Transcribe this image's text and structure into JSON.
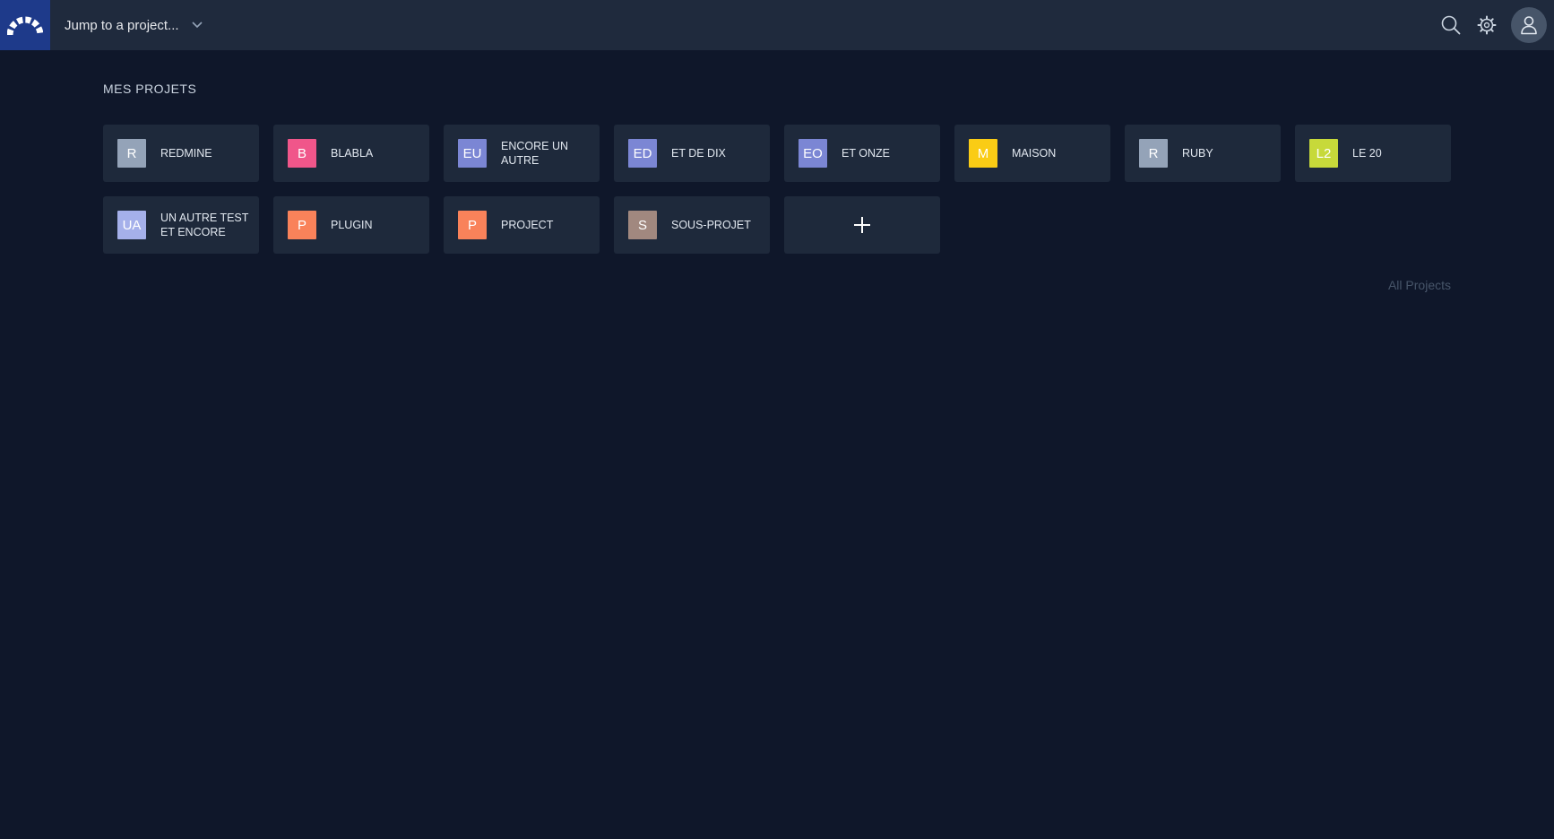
{
  "header": {
    "jump_label": "Jump to a project...",
    "icons": [
      "search-icon",
      "gear-icon",
      "user-icon"
    ]
  },
  "main": {
    "section_title": "MES PROJETS",
    "projects": [
      {
        "initials": "R",
        "name": "REDMINE",
        "color": "#94a3b8"
      },
      {
        "initials": "B",
        "name": "BLABLA",
        "color": "#f0568a"
      },
      {
        "initials": "EU",
        "name": "ENCORE UN AUTRE",
        "color": "#7b86d4"
      },
      {
        "initials": "ED",
        "name": "ET DE DIX",
        "color": "#7b86d4"
      },
      {
        "initials": "EO",
        "name": "ET ONZE",
        "color": "#7b86d4"
      },
      {
        "initials": "M",
        "name": "MAISON",
        "color": "#facc15"
      },
      {
        "initials": "R",
        "name": "RUBY",
        "color": "#94a3b8"
      },
      {
        "initials": "L2",
        "name": "LE 20",
        "color": "#c7d93a"
      },
      {
        "initials": "UA",
        "name": "UN AUTRE TEST ET ENCORE",
        "color": "#a5b0ea"
      },
      {
        "initials": "P",
        "name": "PLUGIN",
        "color": "#f9825a"
      },
      {
        "initials": "P",
        "name": "PROJECT",
        "color": "#f9825a"
      },
      {
        "initials": "S",
        "name": "SOUS-PROJET",
        "color": "#a1887f"
      }
    ],
    "add_icon": "plus-icon",
    "all_projects_label": "All Projects"
  }
}
